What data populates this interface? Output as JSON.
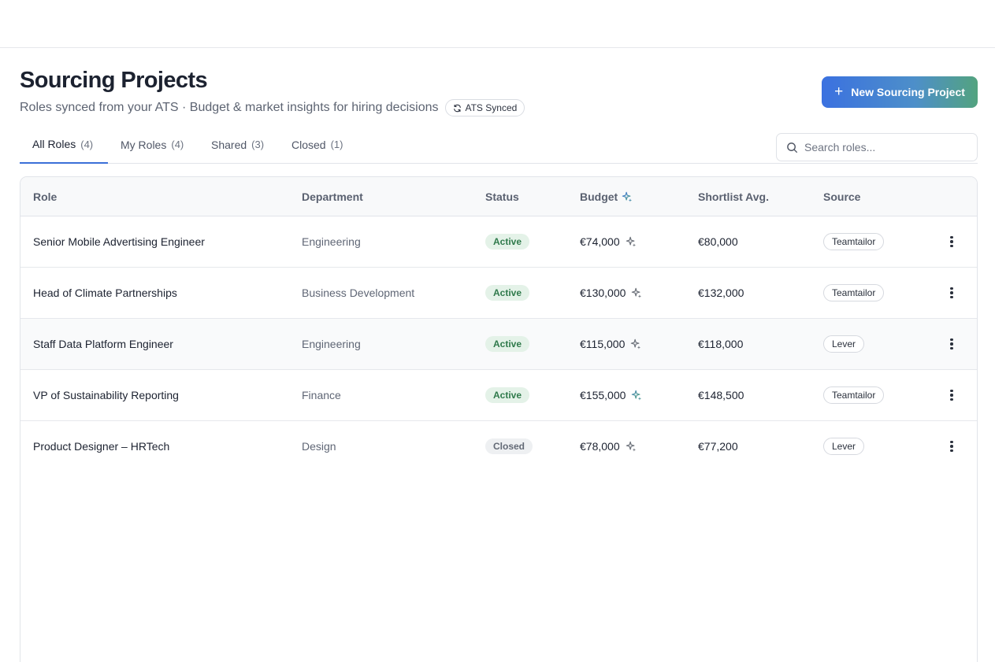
{
  "page": {
    "title": "Sourcing Projects",
    "subtitle": "Roles synced from your ATS · Budget & market insights for hiring decisions",
    "sync_badge": "ATS Synced",
    "new_button": "New Sourcing Project"
  },
  "tabs": [
    {
      "label": "All Roles",
      "count": "(4)",
      "active": true
    },
    {
      "label": "My Roles",
      "count": "(4)",
      "active": false
    },
    {
      "label": "Shared",
      "count": "(3)",
      "active": false
    },
    {
      "label": "Closed",
      "count": "(1)",
      "active": false
    }
  ],
  "search": {
    "placeholder": "Search roles..."
  },
  "table": {
    "headers": {
      "role": "Role",
      "department": "Department",
      "status": "Status",
      "budget": "Budget",
      "shortlist": "Shortlist Avg.",
      "source": "Source"
    },
    "rows": [
      {
        "role": "Senior Mobile Advertising Engineer",
        "department": "Engineering",
        "status": "Active",
        "budget": "€74,000",
        "shortlist": "€80,000",
        "source": "Teamtailor"
      },
      {
        "role": "Head of Climate Partnerships",
        "department": "Business Development",
        "status": "Active",
        "budget": "€130,000",
        "shortlist": "€132,000",
        "source": "Teamtailor"
      },
      {
        "role": "Staff Data Platform Engineer",
        "department": "Engineering",
        "status": "Active",
        "budget": "€115,000",
        "shortlist": "€118,000",
        "source": "Lever"
      },
      {
        "role": "VP of Sustainability Reporting",
        "department": "Finance",
        "status": "Active",
        "budget": "€155,000",
        "shortlist": "€148,500",
        "source": "Teamtailor"
      },
      {
        "role": "Product Designer – HRTech",
        "department": "Design",
        "status": "Closed",
        "budget": "€78,000",
        "shortlist": "€77,200",
        "source": "Lever"
      }
    ]
  },
  "icons": {
    "sparkle": "sparkle-icon",
    "sync": "sync-icon",
    "search": "search-icon",
    "plus": "plus-icon",
    "kebab": "more-vertical-icon"
  },
  "colors": {
    "accent_blue": "#3b71e0",
    "accent_green": "#53a37f",
    "active_bg": "#e4f2e8",
    "active_text": "#2f7a4b",
    "closed_bg": "#eef0f2"
  }
}
